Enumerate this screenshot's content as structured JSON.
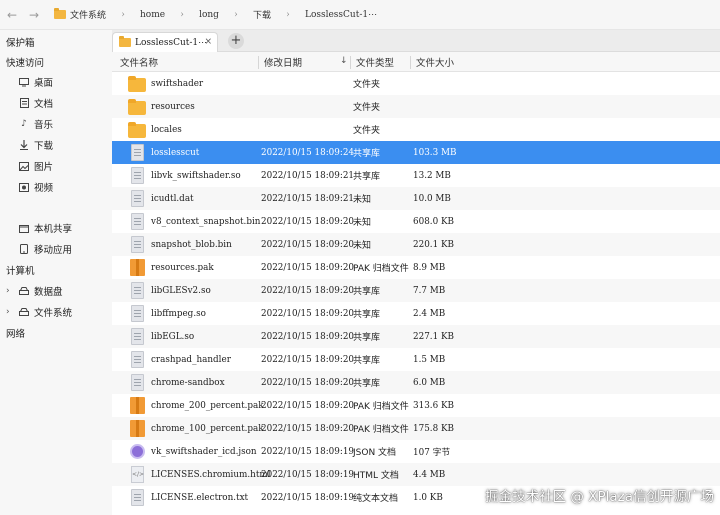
{
  "breadcrumbs": [
    "文件系统",
    "home",
    "long",
    "下载",
    "LosslessCut-1⋯"
  ],
  "sidebar": {
    "protect": "保护箱",
    "quick_access": "快速访问",
    "quick_items": [
      {
        "label": "桌面",
        "icon": "desktop-icon"
      },
      {
        "label": "文档",
        "icon": "document-icon"
      },
      {
        "label": "音乐",
        "icon": "music-icon"
      },
      {
        "label": "下载",
        "icon": "download-icon"
      },
      {
        "label": "图片",
        "icon": "image-icon"
      },
      {
        "label": "视频",
        "icon": "video-icon"
      }
    ],
    "share": "本机共享",
    "mobile_apps": "移动应用",
    "computer": "计算机",
    "data_disk": "数据盘",
    "file_system": "文件系统",
    "network": "网络"
  },
  "tab": {
    "label": "LosslessCut-1⋯",
    "close": "×",
    "add": "+"
  },
  "columns": {
    "name": "文件名称",
    "date": "修改日期",
    "kind": "文件类型",
    "size": "文件大小"
  },
  "files": [
    {
      "name": "swiftshader",
      "date": "",
      "kind": "文件夹",
      "size": "",
      "icon": "folder-icon"
    },
    {
      "name": "resources",
      "date": "",
      "kind": "文件夹",
      "size": "",
      "icon": "folder-icon"
    },
    {
      "name": "locales",
      "date": "",
      "kind": "文件夹",
      "size": "",
      "icon": "folder-icon"
    },
    {
      "name": "losslesscut",
      "date": "2022/10/15 18:09:24",
      "kind": "共享库",
      "size": "103.3  MB",
      "icon": "file-icon",
      "selected": true
    },
    {
      "name": "libvk_swiftshader.so",
      "date": "2022/10/15 18:09:21",
      "kind": "共享库",
      "size": "13.2  MB",
      "icon": "file-icon"
    },
    {
      "name": "icudtl.dat",
      "date": "2022/10/15 18:09:21",
      "kind": "未知",
      "size": "10.0  MB",
      "icon": "file-icon"
    },
    {
      "name": "v8_context_snapshot.bin",
      "date": "2022/10/15 18:09:20",
      "kind": "未知",
      "size": "608.0  KB",
      "icon": "file-icon"
    },
    {
      "name": "snapshot_blob.bin",
      "date": "2022/10/15 18:09:20",
      "kind": "未知",
      "size": "220.1  KB",
      "icon": "file-icon"
    },
    {
      "name": "resources.pak",
      "date": "2022/10/15 18:09:20",
      "kind": "PAK 归档文件",
      "size": "8.9  MB",
      "icon": "archive-icon"
    },
    {
      "name": "libGLESv2.so",
      "date": "2022/10/15 18:09:20",
      "kind": "共享库",
      "size": "7.7  MB",
      "icon": "file-icon"
    },
    {
      "name": "libffmpeg.so",
      "date": "2022/10/15 18:09:20",
      "kind": "共享库",
      "size": "2.4  MB",
      "icon": "file-icon"
    },
    {
      "name": "libEGL.so",
      "date": "2022/10/15 18:09:20",
      "kind": "共享库",
      "size": "227.1  KB",
      "icon": "file-icon"
    },
    {
      "name": "crashpad_handler",
      "date": "2022/10/15 18:09:20",
      "kind": "共享库",
      "size": "1.5  MB",
      "icon": "file-icon"
    },
    {
      "name": "chrome-sandbox",
      "date": "2022/10/15 18:09:20",
      "kind": "共享库",
      "size": "6.0  MB",
      "icon": "file-icon"
    },
    {
      "name": "chrome_200_percent.pak",
      "date": "2022/10/15 18:09:20",
      "kind": "PAK 归档文件",
      "size": "313.6  KB",
      "icon": "archive-icon"
    },
    {
      "name": "chrome_100_percent.pak",
      "date": "2022/10/15 18:09:20",
      "kind": "PAK 归档文件",
      "size": "175.8  KB",
      "icon": "archive-icon"
    },
    {
      "name": "vk_swiftshader_icd.json",
      "date": "2022/10/15 18:09:19",
      "kind": "JSON 文档",
      "size": "107 字节",
      "icon": "json-icon"
    },
    {
      "name": "LICENSES.chromium.html",
      "date": "2022/10/15 18:09:19",
      "kind": "HTML 文档",
      "size": "4.4  MB",
      "icon": "html-icon"
    },
    {
      "name": "LICENSE.electron.txt",
      "date": "2022/10/15 18:09:19",
      "kind": "纯文本文档",
      "size": "1.0  KB",
      "icon": "file-icon"
    }
  ],
  "watermark": "掘金技术社区 @ XPlaza信创开源广场",
  "colors": {
    "selected": "#3b8ef0",
    "folder": "#f6b73c",
    "archive": "#f19a35"
  }
}
